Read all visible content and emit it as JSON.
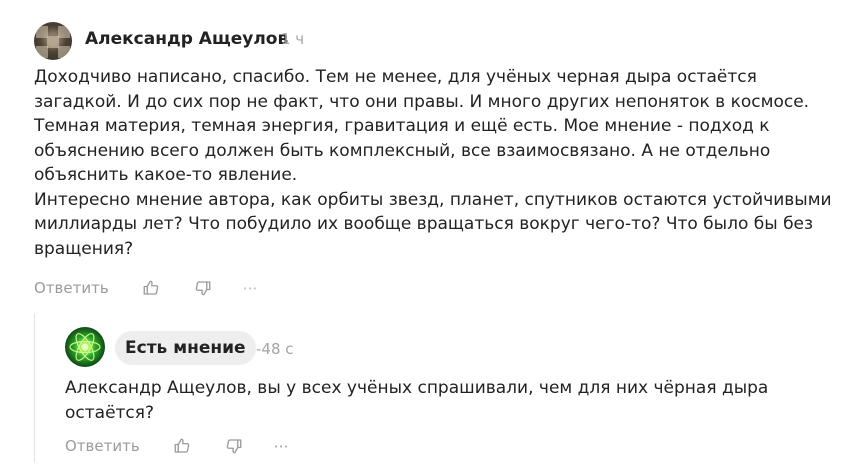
{
  "comment": {
    "author": "Александр Ащеулов",
    "time": "1 ч",
    "paragraphs": [
      "Доходчиво написано, спасибо. Тем не менее, для учёных черная дыра остаётся загадкой. И до сих пор не факт, что они правы. И много других непоняток в космосе. Темная материя, темная энергия, гравитация и ещё есть. Мое мнение - подход к объяснению всего должен быть комплексный, все взаимосвязано. А не отдельно объяснить какое-то явление.",
      "Интересно мнение автора, как орбиты звезд, планет, спутников остаются устойчивыми миллиарды лет? Что побудило их вообще вращаться вокруг чего-то? Что было бы без вращения?"
    ],
    "actions": {
      "reply_label": "Ответить",
      "like_icon": "thumbs-up-icon",
      "dislike_icon": "thumbs-down-icon",
      "more_icon": "more-icon"
    }
  },
  "reply": {
    "author": "Есть мнение",
    "time": "-48 с",
    "text": "Александр Ащеулов, вы у всех учёных спрашивали, чем для них чёрная дыра остаётся?",
    "actions": {
      "reply_label": "Ответить",
      "like_icon": "thumbs-up-icon",
      "dislike_icon": "thumbs-down-icon",
      "more_icon": "more-icon"
    }
  },
  "colors": {
    "muted": "#9b9b9b",
    "text": "#222222",
    "chip_bg": "#eeeeee"
  }
}
